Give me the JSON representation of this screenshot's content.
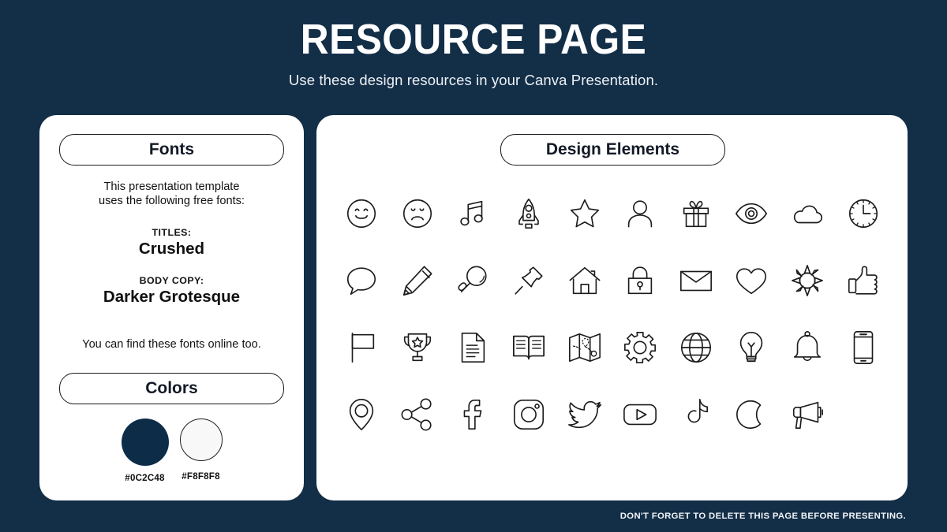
{
  "header": {
    "title": "RESOURCE PAGE",
    "subtitle": "Use these design resources in your Canva Presentation."
  },
  "left_card": {
    "fonts_heading": "Fonts",
    "intro_line1": "This presentation template",
    "intro_line2": "uses the following free fonts:",
    "titles_label": "TITLES:",
    "titles_font": "Crushed",
    "body_label": "BODY COPY:",
    "body_font": "Darker Grotesque",
    "online_note": "You can find these fonts online too.",
    "colors_heading": "Colors",
    "swatches": [
      {
        "hex": "#0C2C48",
        "color": "#0C2C48"
      },
      {
        "hex": "#F8F8F8",
        "color": "#F8F8F8"
      }
    ]
  },
  "right_card": {
    "heading": "Design Elements",
    "icons": [
      "smiley-face-icon",
      "sad-face-icon",
      "music-note-icon",
      "rocket-icon",
      "star-icon",
      "person-icon",
      "gift-icon",
      "eye-icon",
      "cloud-icon",
      "clock-icon",
      "speech-bubble-icon",
      "pencil-icon",
      "magnifying-glass-icon",
      "push-pin-icon",
      "house-icon",
      "lock-icon",
      "envelope-icon",
      "heart-icon",
      "sun-icon",
      "thumbs-up-icon",
      "flag-icon",
      "trophy-icon",
      "document-icon",
      "open-book-icon",
      "map-icon",
      "gear-icon",
      "globe-icon",
      "lightbulb-icon",
      "bell-icon",
      "smartphone-icon",
      "map-pin-icon",
      "share-icon",
      "facebook-icon",
      "instagram-icon",
      "twitter-icon",
      "youtube-icon",
      "tiktok-icon",
      "moon-icon",
      "megaphone-icon"
    ]
  },
  "footer": {
    "note": "DON'T FORGET TO DELETE THIS PAGE BEFORE PRESENTING."
  },
  "theme": {
    "background": "#132E47",
    "card": "#FFFFFF",
    "ink": "#121212"
  }
}
